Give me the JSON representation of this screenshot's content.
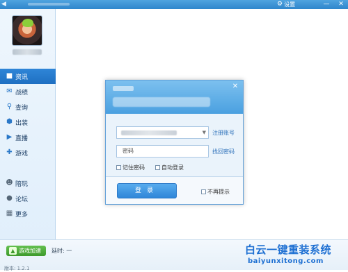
{
  "titlebar": {
    "settings_label": "设置",
    "settings_icon": "gear-icon",
    "min_icon": "minimize-icon",
    "close_icon": "close-icon"
  },
  "sidebar": {
    "items": [
      {
        "label": "资讯",
        "icon": "news-icon",
        "active": true
      },
      {
        "label": "战绩",
        "icon": "record-icon"
      },
      {
        "label": "查询",
        "icon": "search-icon"
      },
      {
        "label": "出装",
        "icon": "equipment-icon"
      },
      {
        "label": "直播",
        "icon": "play-icon"
      },
      {
        "label": "游戏",
        "icon": "gamepad-icon"
      }
    ],
    "items2": [
      {
        "label": "陪玩",
        "icon": "users-icon"
      },
      {
        "label": "论坛",
        "icon": "chat-icon"
      },
      {
        "label": "更多",
        "icon": "grid-icon"
      }
    ]
  },
  "statusbar": {
    "accel_label": "游戏加速",
    "latency_label": "延时: 一",
    "version_label": "版本: 1.2.1"
  },
  "watermark": {
    "cn": "白云一键重装系统",
    "en": "baiyunxitong.com"
  },
  "dialog": {
    "register_link": "注册账号",
    "password_placeholder": "密码",
    "recover_link": "找回密码",
    "remember_label": "记住密码",
    "autologin_label": "自动登录",
    "login_button": "登录",
    "no_remind_label": "不再提示"
  }
}
